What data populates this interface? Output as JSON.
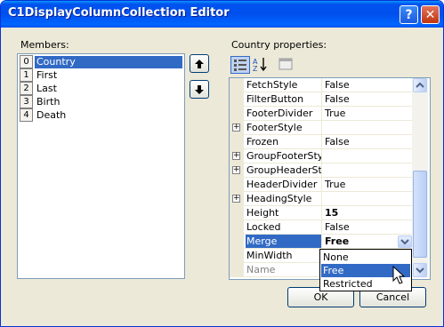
{
  "window": {
    "title": "C1DisplayColumnCollection Editor"
  },
  "titlebar": {
    "help_label": "?",
    "close_label": "✕"
  },
  "members": {
    "label": "Members:",
    "items": [
      {
        "index": "0",
        "name": "Country",
        "selected": true
      },
      {
        "index": "1",
        "name": "First"
      },
      {
        "index": "2",
        "name": "Last"
      },
      {
        "index": "3",
        "name": "Birth"
      },
      {
        "index": "4",
        "name": "Death"
      }
    ]
  },
  "properties": {
    "label": "Country properties:",
    "rows": [
      {
        "name": "FetchStyle",
        "value": "False"
      },
      {
        "name": "FilterButton",
        "value": "False"
      },
      {
        "name": "FooterDivider",
        "value": "True"
      },
      {
        "name": "FooterStyle",
        "value": "",
        "expandable": true
      },
      {
        "name": "Frozen",
        "value": "False"
      },
      {
        "name": "GroupFooterStyle",
        "value": "",
        "expandable": true
      },
      {
        "name": "GroupHeaderStyle",
        "value": "",
        "expandable": true
      },
      {
        "name": "HeaderDivider",
        "value": "True"
      },
      {
        "name": "HeadingStyle",
        "value": "",
        "expandable": true
      },
      {
        "name": "Height",
        "value": "15",
        "bold": true
      },
      {
        "name": "Locked",
        "value": "False"
      },
      {
        "name": "Merge",
        "value": "Free",
        "bold": true,
        "selected": true
      },
      {
        "name": "MinWidth",
        "value": ""
      },
      {
        "name": "Name",
        "value": "",
        "dim": true
      }
    ]
  },
  "merge_dropdown": {
    "options": [
      "None",
      "Free",
      "Restricted"
    ],
    "selected": "Free"
  },
  "buttons": {
    "ok": "OK",
    "cancel": "Cancel"
  },
  "colors": {
    "title_bar": "#0053ee",
    "selection": "#316ac5",
    "dialog_bg": "#ece9d8"
  }
}
